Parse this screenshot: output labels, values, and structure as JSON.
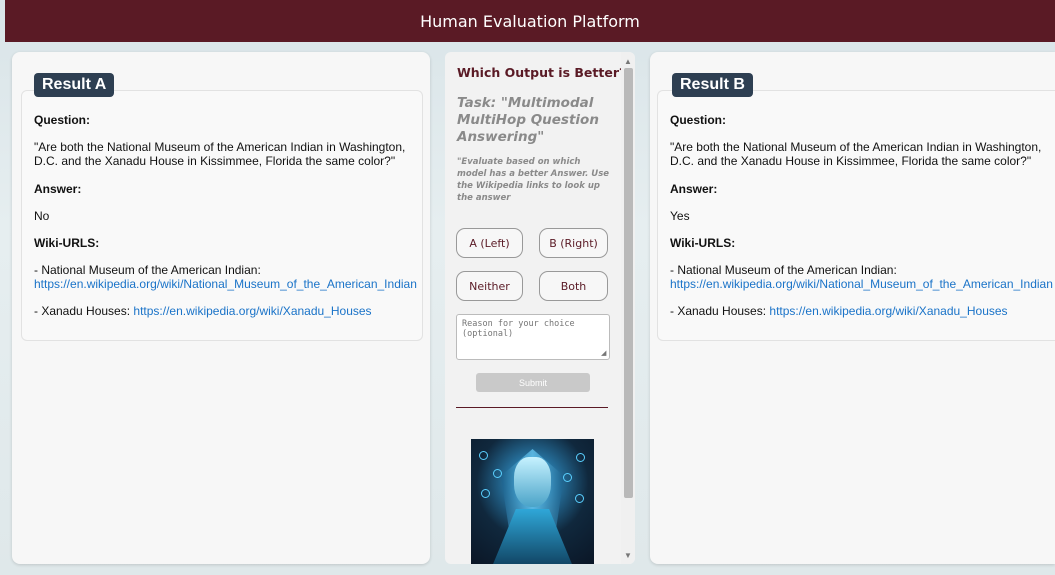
{
  "header": {
    "title": "Human Evaluation Platform"
  },
  "result_a": {
    "badge": "Result A",
    "question_label": "Question:",
    "question": "\"Are both the National Museum of the American Indian in Washington, D.C. and the Xanadu House in Kissimmee, Florida the same color?\"",
    "answer_label": "Answer:",
    "answer": "No",
    "wiki_label": "Wiki-URLS:",
    "wiki1_prefix": "- National Museum of the American Indian:",
    "wiki1_url": "https://en.wikipedia.org/wiki/National_Museum_of_the_American_Indian",
    "wiki2_prefix": "- Xanadu Houses:",
    "wiki2_url": "https://en.wikipedia.org/wiki/Xanadu_Houses"
  },
  "result_b": {
    "badge": "Result B",
    "question_label": "Question:",
    "question": "\"Are both the National Museum of the American Indian in Washington, D.C. and the Xanadu House in Kissimmee, Florida the same color?\"",
    "answer_label": "Answer:",
    "answer": "Yes",
    "wiki_label": "Wiki-URLS:",
    "wiki1_prefix": "- National Museum of the American Indian:",
    "wiki1_url": "https://en.wikipedia.org/wiki/National_Museum_of_the_American_Indian",
    "wiki2_prefix": "- Xanadu Houses:",
    "wiki2_url": "https://en.wikipedia.org/wiki/Xanadu_Houses"
  },
  "center": {
    "heading": "Which Output is Better?",
    "task_title": "Task: \"Multimodal MultiHop Question Answering\"",
    "task_desc": "\"Evaluate based on which model has a better Answer. Use the Wikipedia links to look up the answer",
    "choices": {
      "a": "A (Left)",
      "b": "B (Right)",
      "neither": "Neither",
      "both": "Both"
    },
    "reason_placeholder": "Reason for your choice (optional)",
    "submit_label": "Submit"
  },
  "colors": {
    "brand": "#5a1a25",
    "badge": "#2e3f52",
    "link": "#1a73c8"
  },
  "icons": {
    "scroll_up": "triangle-up",
    "scroll_down": "triangle-down"
  }
}
